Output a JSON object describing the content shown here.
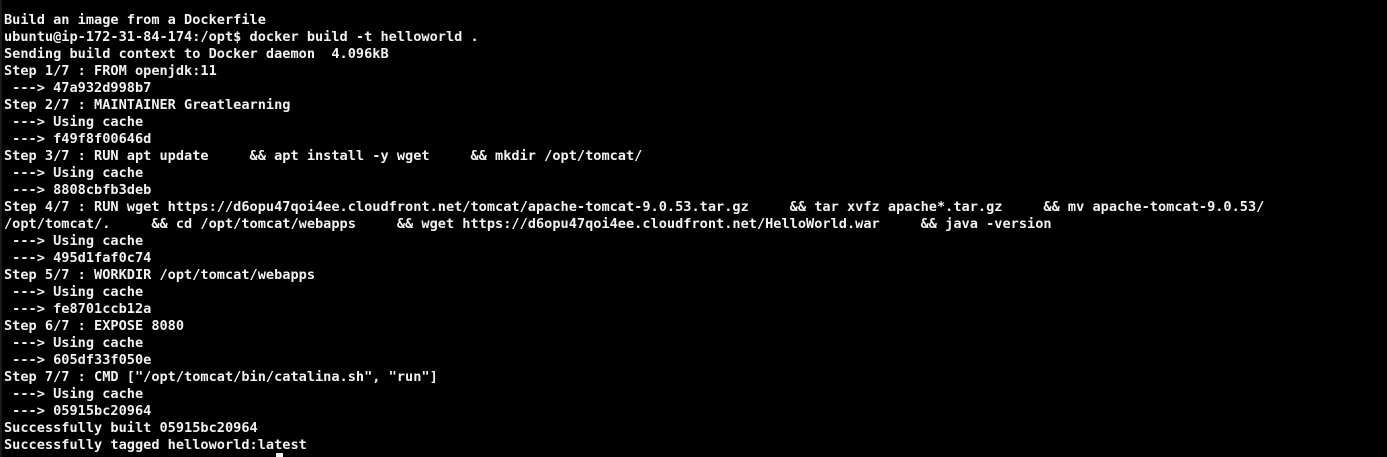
{
  "terminal": {
    "lines": [
      "Build an image from a Dockerfile",
      "ubuntu@ip-172-31-84-174:/opt$ docker build -t helloworld .",
      "Sending build context to Docker daemon  4.096kB",
      "Step 1/7 : FROM openjdk:11",
      " ---> 47a932d998b7",
      "Step 2/7 : MAINTAINER Greatlearning",
      " ---> Using cache",
      " ---> f49f8f00646d",
      "Step 3/7 : RUN apt update     && apt install -y wget     && mkdir /opt/tomcat/",
      " ---> Using cache",
      " ---> 8808cbfb3deb",
      "Step 4/7 : RUN wget https://d6opu47qoi4ee.cloudfront.net/tomcat/apache-tomcat-9.0.53.tar.gz     && tar xvfz apache*.tar.gz     && mv apache-tomcat-9.0.53/",
      "/opt/tomcat/.     && cd /opt/tomcat/webapps     && wget https://d6opu47qoi4ee.cloudfront.net/HelloWorld.war     && java -version",
      " ---> Using cache",
      " ---> 495d1faf0c74",
      "Step 5/7 : WORKDIR /opt/tomcat/webapps",
      " ---> Using cache",
      " ---> fe8701ccb12a",
      "Step 6/7 : EXPOSE 8080",
      " ---> Using cache",
      " ---> 605df33f050e",
      "Step 7/7 : CMD [\"/opt/tomcat/bin/catalina.sh\", \"run\"]",
      " ---> Using cache",
      " ---> 05915bc20964",
      "Successfully built 05915bc20964",
      "Successfully tagged helloworld:latest"
    ]
  },
  "colors": {
    "background": "#000000",
    "text": "#f2f2f2"
  }
}
